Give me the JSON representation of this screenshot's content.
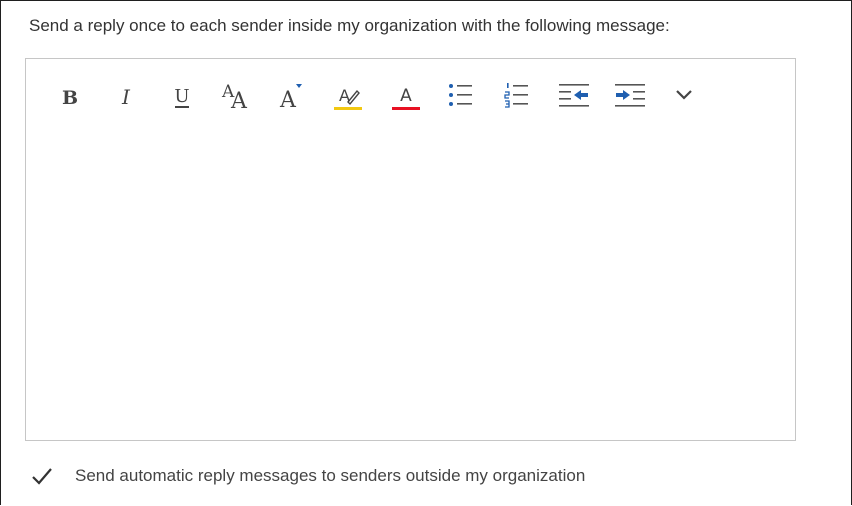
{
  "prompt_text": "Send a reply once to each sender inside my organization with the following message:",
  "editor": {
    "body_text": ""
  },
  "toolbar": {
    "bold_glyph": "B",
    "italic_glyph": "I",
    "underline_glyph": "U",
    "font_size_glyph_small": "A",
    "font_size_glyph_large": "A",
    "grow_font_glyph": "A",
    "highlight_glyph": "A",
    "font_color_glyph": "A",
    "highlight_color": "#f2c811",
    "font_color_color": "#e81123",
    "icon_blue": "#1f5fb0",
    "icons": [
      "bold-icon",
      "italic-icon",
      "underline-icon",
      "font-size-icon",
      "grow-font-icon",
      "highlight-icon",
      "font-color-icon",
      "bullets-icon",
      "numbering-icon",
      "decrease-indent-icon",
      "increase-indent-icon",
      "chevron-down-icon"
    ]
  },
  "external": {
    "checked": true,
    "label": "Send automatic reply messages to senders outside my organization"
  }
}
